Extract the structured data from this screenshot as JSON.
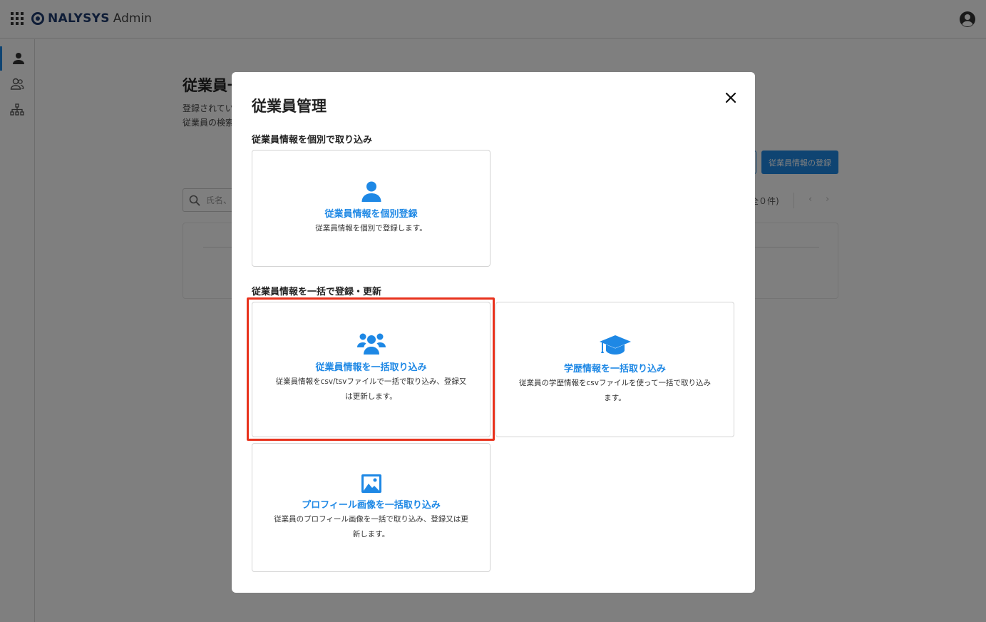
{
  "app": {
    "logo_text": "NALYSYS",
    "logo_suffix": "Admin"
  },
  "background": {
    "page_title": "従業員一",
    "description_line1": "登録されてい",
    "description_line2": "従業員の検索",
    "register_button": "従業員情報の登録",
    "search_placeholder": "氏名、",
    "count_label": "全０件)",
    "prev": "‹",
    "next": "›"
  },
  "modal": {
    "title": "従業員管理",
    "section_individual": "従業員情報を個別で取り込み",
    "section_bulk": "従業員情報を一括で登録・更新",
    "cards": {
      "individual": {
        "title": "従業員情報を個別登録",
        "desc": "従業員情報を個別で登録します。",
        "icon": "person-icon"
      },
      "bulk": {
        "title": "従業員情報を一括取り込み",
        "desc": "従業員情報をcsv/tsvファイルで一括で取り込み、登録又は更新します。",
        "icon": "group-icon"
      },
      "education": {
        "title": "学歴情報を一括取り込み",
        "desc": "従業員の学歴情報をcsvファイルを使って一括で取り込みます。",
        "icon": "graduation-cap-icon"
      },
      "profile_image": {
        "title": "プロフィール画像を一括取り込み",
        "desc": "従業員のプロフィール画像を一括で取り込み、登録又は更新します。",
        "icon": "image-icon"
      }
    }
  },
  "colors": {
    "accent": "#1e88e5",
    "highlight": "#e8321d",
    "brand": "#1f3b6e"
  }
}
